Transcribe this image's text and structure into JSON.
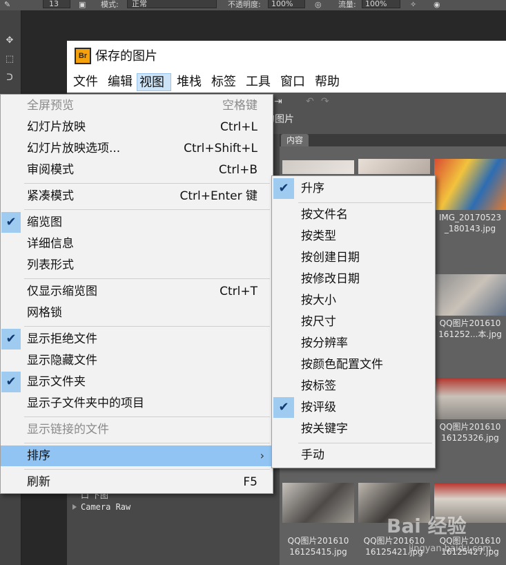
{
  "photoshop": {
    "brush_size": "13",
    "mode_label": "模式:",
    "mode_value": "正常",
    "opacity_label": "不透明度:",
    "opacity_value": "100%",
    "flow_label": "流量:",
    "flow_value": "100%"
  },
  "bridge": {
    "logo_text": "Br",
    "window_title": "保存的图片",
    "menubar": [
      "文件",
      "编辑",
      "视图",
      "堆栈",
      "标签",
      "工具",
      "窗口",
      "帮助"
    ],
    "active_menu": "视图",
    "path_text": "的图片",
    "content_tab": "内容",
    "sidebar_item": "Camera Raw",
    "sidebar_partial": "口 下图"
  },
  "view_menu": {
    "items": [
      {
        "label": "全屏预览",
        "shortcut": "空格键",
        "disabled": true
      },
      {
        "label": "幻灯片放映",
        "shortcut": "Ctrl+L"
      },
      {
        "label": "幻灯片放映选项...",
        "shortcut": "Ctrl+Shift+L"
      },
      {
        "label": "审阅模式",
        "shortcut": "Ctrl+B"
      },
      {
        "label": "紧凑模式",
        "shortcut": "Ctrl+Enter 键"
      },
      {
        "label": "缩览图",
        "checked": true
      },
      {
        "label": "详细信息"
      },
      {
        "label": "列表形式"
      },
      {
        "label": "仅显示缩览图",
        "shortcut": "Ctrl+T"
      },
      {
        "label": "网格锁"
      },
      {
        "label": "显示拒绝文件",
        "checked": true
      },
      {
        "label": "显示隐藏文件"
      },
      {
        "label": "显示文件夹",
        "checked": true
      },
      {
        "label": "显示子文件夹中的项目"
      },
      {
        "label": "显示链接的文件",
        "disabled": true
      },
      {
        "label": "排序",
        "highlighted": true,
        "submenu_arrow": "›"
      },
      {
        "label": "刷新",
        "shortcut": "F5"
      }
    ]
  },
  "sort_submenu": {
    "items": [
      {
        "label": "升序",
        "checked": true
      },
      {
        "label": "按文件名"
      },
      {
        "label": "按类型"
      },
      {
        "label": "按创建日期"
      },
      {
        "label": "按修改日期"
      },
      {
        "label": "按大小"
      },
      {
        "label": "按尺寸"
      },
      {
        "label": "按分辨率"
      },
      {
        "label": "按颜色配置文件"
      },
      {
        "label": "按标签"
      },
      {
        "label": "按评级",
        "checked": true
      },
      {
        "label": "按关键字"
      },
      {
        "label": "手动"
      }
    ]
  },
  "thumbnails": [
    {
      "line1": "IMG_20170523",
      "line2": "_180143.jpg"
    },
    {
      "line1": "QQ图片201610",
      "line2": "161252...本.jpg"
    },
    {
      "line1": "QQ图片201610",
      "line2": "16125326.jpg"
    },
    {
      "line1": "QQ图片201610",
      "line2": "16125415.jpg"
    },
    {
      "line1": "QQ图片201610",
      "line2": "16125421.jpg"
    },
    {
      "line1": "QQ图片201610",
      "line2": "16125427.jpg"
    }
  ],
  "watermark": {
    "brand": "Bai 经验",
    "url": "jingyan.baidu.com"
  },
  "colors": {
    "menu_highlight": "#91c4f2",
    "check_bg": "#9fcbf1",
    "bridge_logo": "#f4a10c"
  }
}
